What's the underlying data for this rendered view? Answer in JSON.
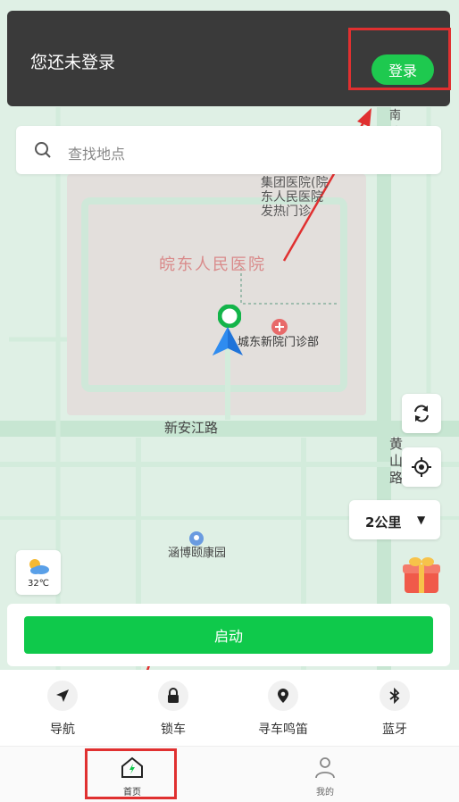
{
  "login_banner": {
    "text": "您还未登录",
    "button_label": "登录"
  },
  "search": {
    "placeholder": "查找地点"
  },
  "map": {
    "hospital_name": "皖东人民医院",
    "poi_top": "集团医院(院\n东人民医院\n发热门诊",
    "poi_clinic": "城东新院门诊部",
    "road_xinanjiang": "新安江路",
    "road_huangshan": "黄山路",
    "road_nan": "南路",
    "poi_park": "涵博颐康园"
  },
  "controls": {
    "distance": "2公里",
    "temperature": "32℃"
  },
  "start_label": "启动",
  "actions": [
    {
      "label": "导航",
      "icon": "navigation-arrow-icon"
    },
    {
      "label": "锁车",
      "icon": "lock-icon"
    },
    {
      "label": "寻车鸣笛",
      "icon": "location-pin-icon"
    },
    {
      "label": "蓝牙",
      "icon": "bluetooth-icon"
    }
  ],
  "tabs": [
    {
      "label": "首页",
      "icon": "home-icon",
      "active": true
    },
    {
      "label": "我的",
      "icon": "user-icon",
      "active": false
    }
  ],
  "colors": {
    "accent": "#0fc94b",
    "annotation": "#e03030",
    "banner": "#3a3a3a"
  }
}
